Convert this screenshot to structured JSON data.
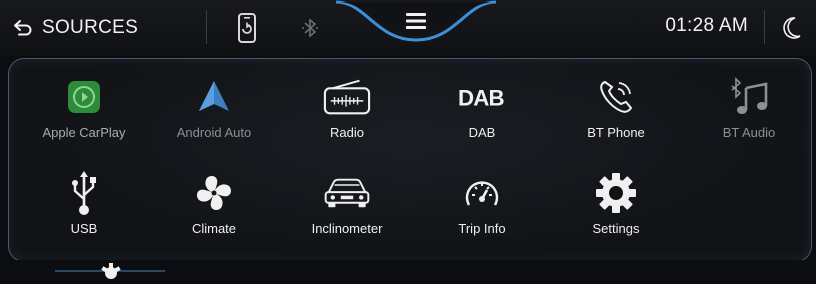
{
  "header": {
    "back_label": "SOURCES",
    "time": "01:28 AM"
  },
  "apps_row1": [
    {
      "label": "Apple CarPlay",
      "icon": "carplay-icon"
    },
    {
      "label": "Android Auto",
      "icon": "android-auto-icon"
    },
    {
      "label": "Radio",
      "icon": "radio-icon"
    },
    {
      "label": "DAB",
      "icon": "dab-icon"
    },
    {
      "label": "BT Phone",
      "icon": "bt-phone-icon"
    },
    {
      "label": "BT Audio",
      "icon": "bt-audio-icon"
    }
  ],
  "apps_row2": [
    {
      "label": "USB",
      "icon": "usb-icon"
    },
    {
      "label": "Climate",
      "icon": "fan-icon"
    },
    {
      "label": "Inclinometer",
      "icon": "car-icon"
    },
    {
      "label": "Trip Info",
      "icon": "gauge-icon"
    },
    {
      "label": "Settings",
      "icon": "gear-icon"
    }
  ],
  "colors": {
    "accent": "#3d8fd6",
    "carplay_green": "#2e8b3a",
    "panel_border": "#4a5a6b"
  }
}
